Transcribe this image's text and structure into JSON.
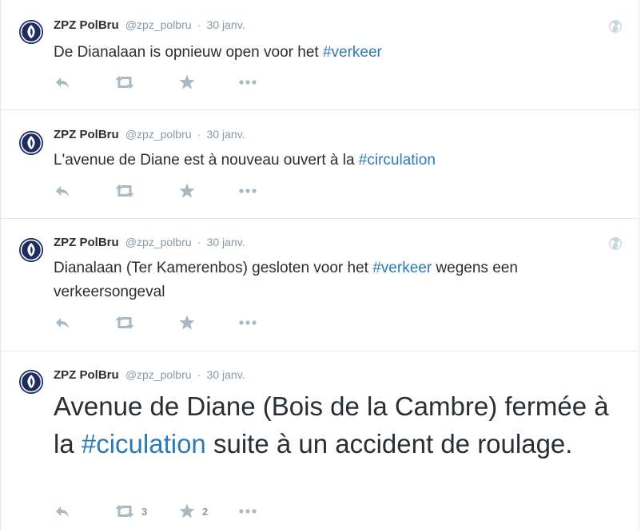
{
  "tweets": [
    {
      "fullname": "ZPZ PolBru",
      "screen_name": "@zpz_polbru",
      "separator": "·",
      "time": "30 janv.",
      "text_before": "De Dianalaan is opnieuw open voor het ",
      "hashtag": "#verkeer",
      "text_after": "",
      "has_globe": true,
      "retweet_count": "",
      "favorite_count": ""
    },
    {
      "fullname": "ZPZ PolBru",
      "screen_name": "@zpz_polbru",
      "separator": "·",
      "time": "30 janv.",
      "text_before": "L'avenue de Diane est à nouveau ouvert à la ",
      "hashtag": "#circulation",
      "text_after": "",
      "has_globe": false,
      "retweet_count": "",
      "favorite_count": ""
    },
    {
      "fullname": "ZPZ PolBru",
      "screen_name": "@zpz_polbru",
      "separator": "·",
      "time": "30 janv.",
      "text_before": "Dianalaan (Ter Kamerenbos) gesloten voor het ",
      "hashtag": "#verkeer",
      "text_after": " wegens een verkeersongeval",
      "has_globe": true,
      "retweet_count": "",
      "favorite_count": ""
    },
    {
      "fullname": "ZPZ PolBru",
      "screen_name": "@zpz_polbru",
      "separator": "·",
      "time": "30 janv.",
      "text_before": "Avenue de Diane (Bois de la Cambre) fermée à la ",
      "hashtag": "#ciculation",
      "text_after": " suite à un accident de roulage.",
      "has_globe": false,
      "retweet_count": "3",
      "favorite_count": "2"
    }
  ],
  "icons": {
    "avatar": "police-flame-logo-icon",
    "globe": "globe-icon",
    "reply": "reply-icon",
    "retweet": "retweet-icon",
    "favorite": "star-icon",
    "more": "more-dots-icon"
  },
  "colors": {
    "hashtag": "#2b7bb9",
    "meta_text": "#8899a6",
    "action_icon": "#aab8c2",
    "divider": "#e1e8ed",
    "avatar_bg": "#1d2d62"
  }
}
